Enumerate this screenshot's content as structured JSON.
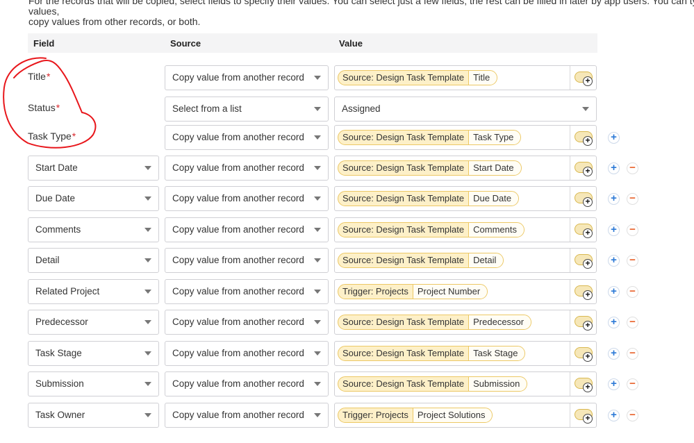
{
  "intro": {
    "line1": "For the records that will be copied, select fields to specify their values. You can select just a few fields; the rest can be filled in later by app users. You can type values,",
    "line2": "copy values from other records, or both."
  },
  "header": {
    "field": "Field",
    "source": "Source",
    "value": "Value"
  },
  "colors": {
    "required_star": "#d9262b",
    "chip_bg": "#fdf0c8",
    "add": "#2a78d6",
    "remove": "#e8632b",
    "annotation": "#e8161b"
  },
  "rows": [
    {
      "field": "Title",
      "required": "*",
      "source": "Copy value from another record",
      "chip_source": "Source: Design Task Template",
      "chip_field": "Title"
    },
    {
      "field": "Status",
      "required": "*",
      "source": "Select from a list",
      "value_text": "Assigned"
    },
    {
      "field": "Task Type",
      "required": "*",
      "source": "Copy value from another record",
      "chip_source": "Source: Design Task Template",
      "chip_field": "Task Type"
    },
    {
      "field": "Start Date",
      "source": "Copy value from another record",
      "chip_source": "Source: Design Task Template",
      "chip_field": "Start Date"
    },
    {
      "field": "Due Date",
      "source": "Copy value from another record",
      "chip_source": "Source: Design Task Template",
      "chip_field": "Due Date"
    },
    {
      "field": "Comments",
      "source": "Copy value from another record",
      "chip_source": "Source: Design Task Template",
      "chip_field": "Comments"
    },
    {
      "field": "Detail",
      "source": "Copy value from another record",
      "chip_source": "Source: Design Task Template",
      "chip_field": "Detail"
    },
    {
      "field": "Related Project",
      "source": "Copy value from another record",
      "chip_source": "Trigger: Projects",
      "chip_field": "Project Number"
    },
    {
      "field": "Predecessor",
      "source": "Copy value from another record",
      "chip_source": "Source: Design Task Template",
      "chip_field": "Predecessor"
    },
    {
      "field": "Task Stage",
      "source": "Copy value from another record",
      "chip_source": "Source: Design Task Template",
      "chip_field": "Task Stage"
    },
    {
      "field": "Submission",
      "source": "Copy value from another record",
      "chip_source": "Source: Design Task Template",
      "chip_field": "Submission"
    },
    {
      "field": "Task Owner",
      "source": "Copy value from another record",
      "chip_source": "Trigger: Projects",
      "chip_field": "Project Solutions"
    }
  ],
  "buttons": {
    "add": "+",
    "remove": "−",
    "toggle_plus": "+"
  }
}
